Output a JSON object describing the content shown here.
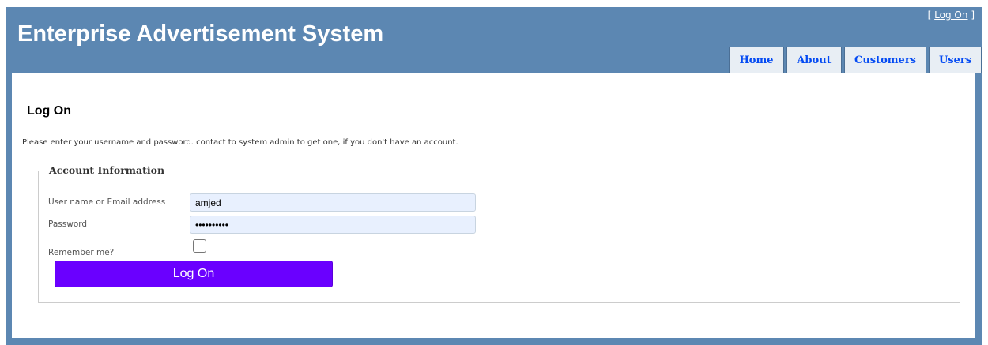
{
  "header": {
    "title": "Enterprise Advertisement System",
    "login_display": {
      "open_bracket": "[",
      "link": "Log On",
      "close_bracket": "]"
    },
    "menu": [
      {
        "label": "Home"
      },
      {
        "label": "About"
      },
      {
        "label": "Customers"
      },
      {
        "label": "Users"
      }
    ]
  },
  "main": {
    "heading": "Log On",
    "instructions": "Please enter your username and password. contact to system admin to get one, if you don't have an account.",
    "fieldset": {
      "legend": "Account Information",
      "username_label": "User name or Email address",
      "username_value": "amjed",
      "password_label": "Password",
      "password_value": "••••••••••",
      "remember_label": "Remember me?",
      "remember_checked": false
    },
    "submit_label": "Log On"
  },
  "colors": {
    "page_background": "#5c87b2",
    "menu_background": "#e8eef4",
    "menu_text": "#034af3",
    "input_background": "#e8f0fe",
    "button_background": "#6a00ff",
    "button_text": "#ffffff"
  }
}
